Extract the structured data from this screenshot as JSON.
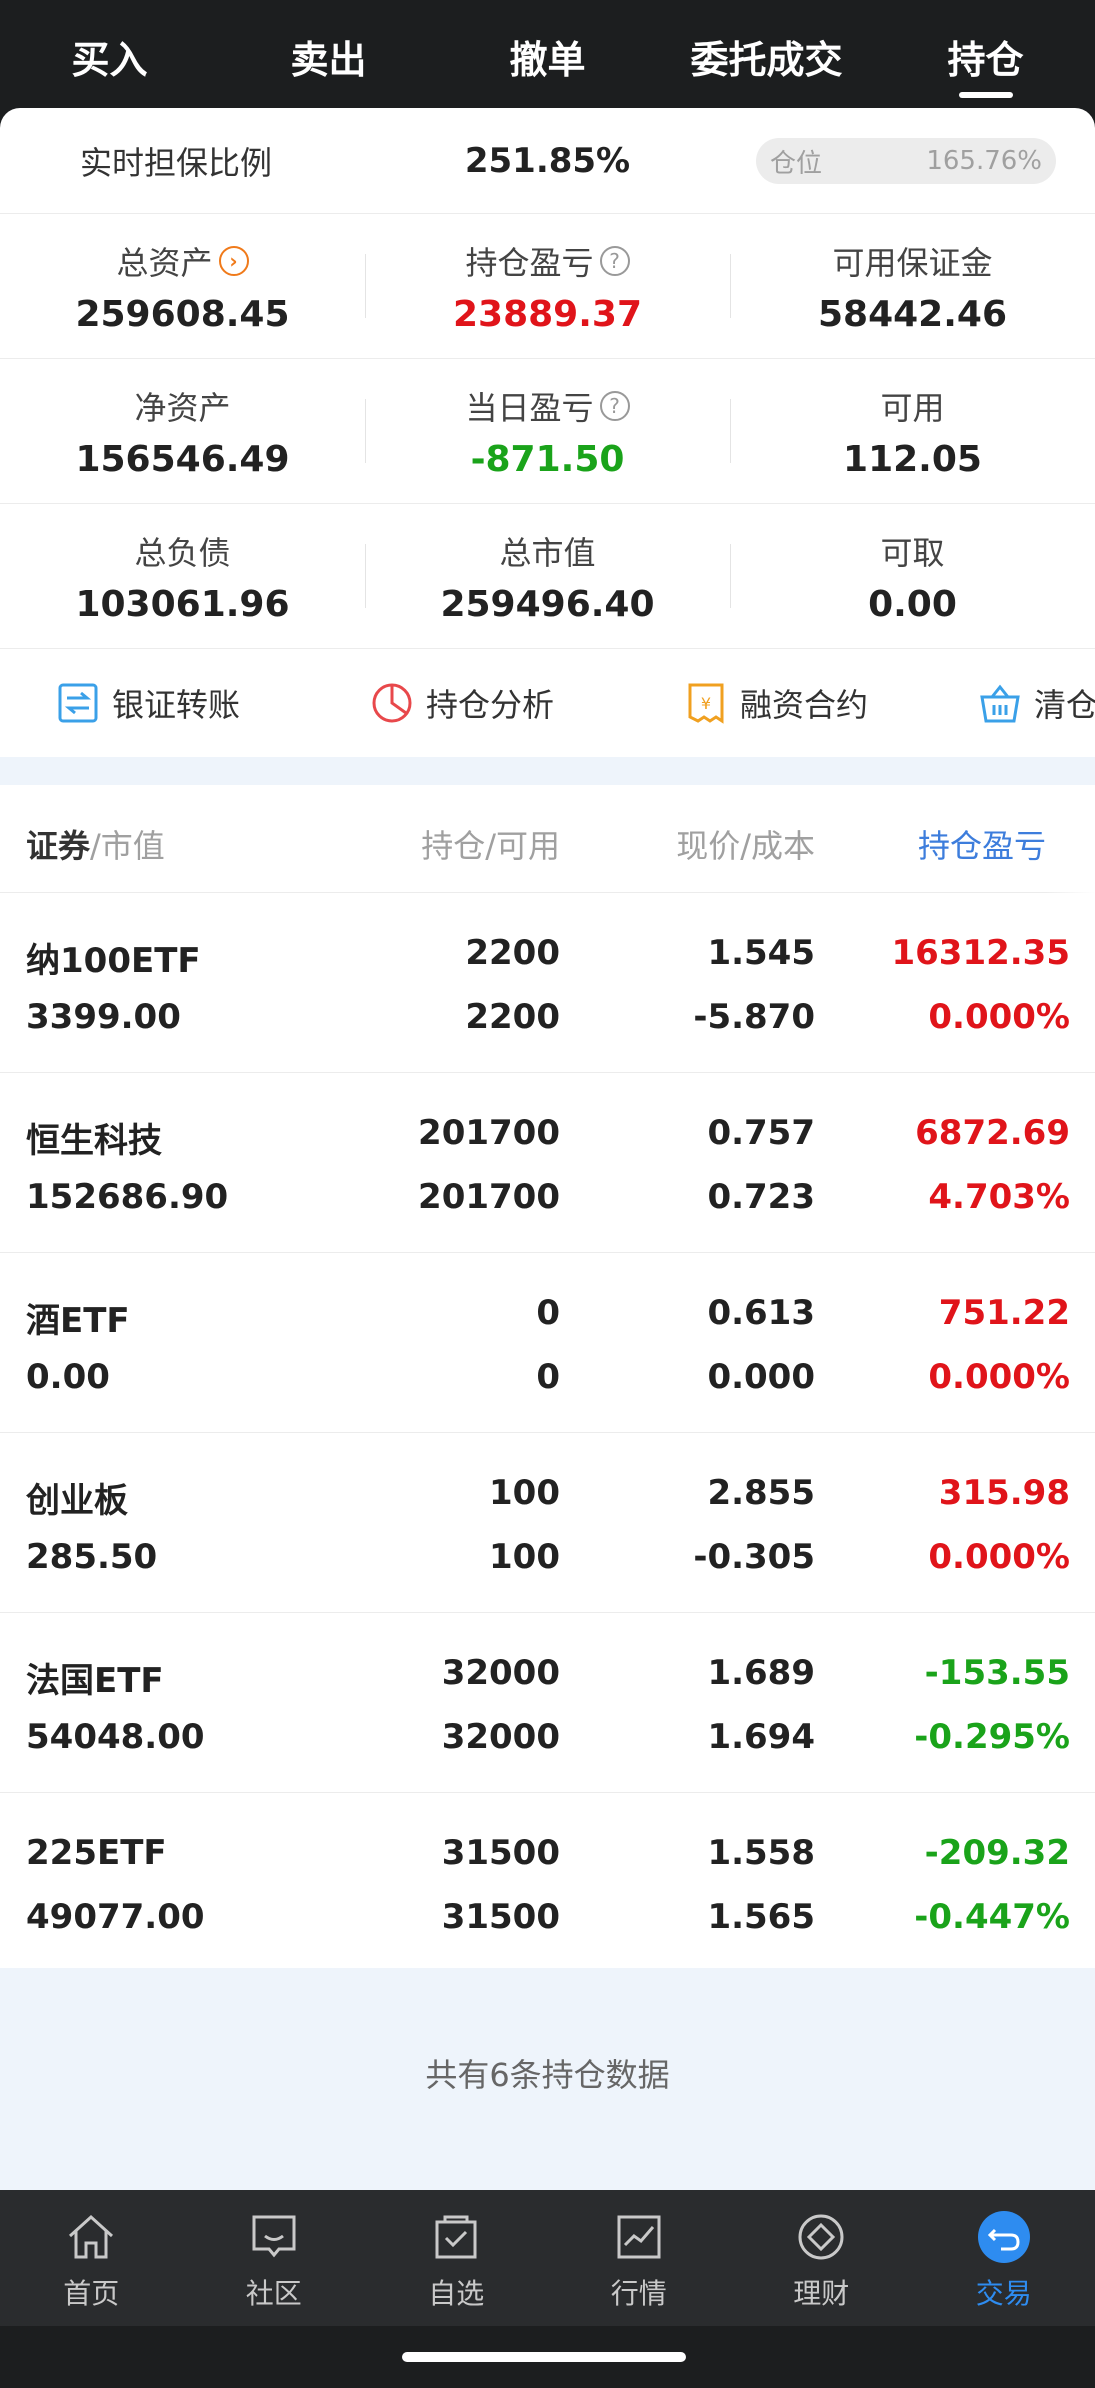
{
  "top_tabs": [
    "买入",
    "卖出",
    "撤单",
    "委托成交",
    "持仓"
  ],
  "active_tab": "持仓",
  "ratio": {
    "label": "实时担保比例",
    "value": "251.85%"
  },
  "position_pill": {
    "label": "仓位",
    "value": "165.76%"
  },
  "stats": [
    [
      {
        "label": "总资产",
        "value": "259608.45",
        "icon": "chevron-right-circle-icon"
      },
      {
        "label": "持仓盈亏",
        "value": "23889.37",
        "icon": "help-icon",
        "color": "red"
      },
      {
        "label": "可用保证金",
        "value": "58442.46"
      }
    ],
    [
      {
        "label": "净资产",
        "value": "156546.49"
      },
      {
        "label": "当日盈亏",
        "value": "-871.50",
        "icon": "help-icon",
        "color": "green"
      },
      {
        "label": "可用",
        "value": "112.05"
      }
    ],
    [
      {
        "label": "总负债",
        "value": "103061.96"
      },
      {
        "label": "总市值",
        "value": "259496.40"
      },
      {
        "label": "可取",
        "value": "0.00"
      }
    ]
  ],
  "actions": [
    {
      "label": "银证转账",
      "icon": "transfer-icon"
    },
    {
      "label": "持仓分析",
      "icon": "pie-chart-icon"
    },
    {
      "label": "融资合约",
      "icon": "contract-icon"
    },
    {
      "label": "清仓",
      "icon": "basket-icon"
    }
  ],
  "table_header": {
    "security": "证券",
    "market_value": "/市值",
    "holding": "持仓/可用",
    "price": "现价/成本",
    "pnl": "持仓盈亏"
  },
  "holdings": [
    {
      "name": "纳100ETF",
      "market_value": "3399.00",
      "holding": "2200",
      "available": "2200",
      "price": "1.545",
      "cost": "-5.870",
      "pnl": "16312.35",
      "pnl_pct": "0.000%",
      "color": "red"
    },
    {
      "name": "恒生科技",
      "market_value": "152686.90",
      "holding": "201700",
      "available": "201700",
      "price": "0.757",
      "cost": "0.723",
      "pnl": "6872.69",
      "pnl_pct": "4.703%",
      "color": "red"
    },
    {
      "name": "酒ETF",
      "market_value": "0.00",
      "holding": "0",
      "available": "0",
      "price": "0.613",
      "cost": "0.000",
      "pnl": "751.22",
      "pnl_pct": "0.000%",
      "color": "red"
    },
    {
      "name": "创业板",
      "market_value": "285.50",
      "holding": "100",
      "available": "100",
      "price": "2.855",
      "cost": "-0.305",
      "pnl": "315.98",
      "pnl_pct": "0.000%",
      "color": "red"
    },
    {
      "name": "法国ETF",
      "market_value": "54048.00",
      "holding": "32000",
      "available": "32000",
      "price": "1.689",
      "cost": "1.694",
      "pnl": "-153.55",
      "pnl_pct": "-0.295%",
      "color": "green"
    },
    {
      "name": "225ETF",
      "market_value": "49077.00",
      "holding": "31500",
      "available": "31500",
      "price": "1.558",
      "cost": "1.565",
      "pnl": "-209.32",
      "pnl_pct": "-0.447%",
      "color": "green"
    }
  ],
  "footer_note": "共有6条持仓数据",
  "bottom_nav": [
    {
      "label": "首页",
      "icon": "home-icon"
    },
    {
      "label": "社区",
      "icon": "community-icon"
    },
    {
      "label": "自选",
      "icon": "watchlist-icon"
    },
    {
      "label": "行情",
      "icon": "market-icon"
    },
    {
      "label": "理财",
      "icon": "wealth-icon"
    },
    {
      "label": "交易",
      "icon": "trade-icon"
    }
  ],
  "active_nav": "交易",
  "colors": {
    "red": "#e0141a",
    "green": "#1aa31a",
    "blue": "#2e8cf0",
    "orange": "#f07a1a"
  }
}
